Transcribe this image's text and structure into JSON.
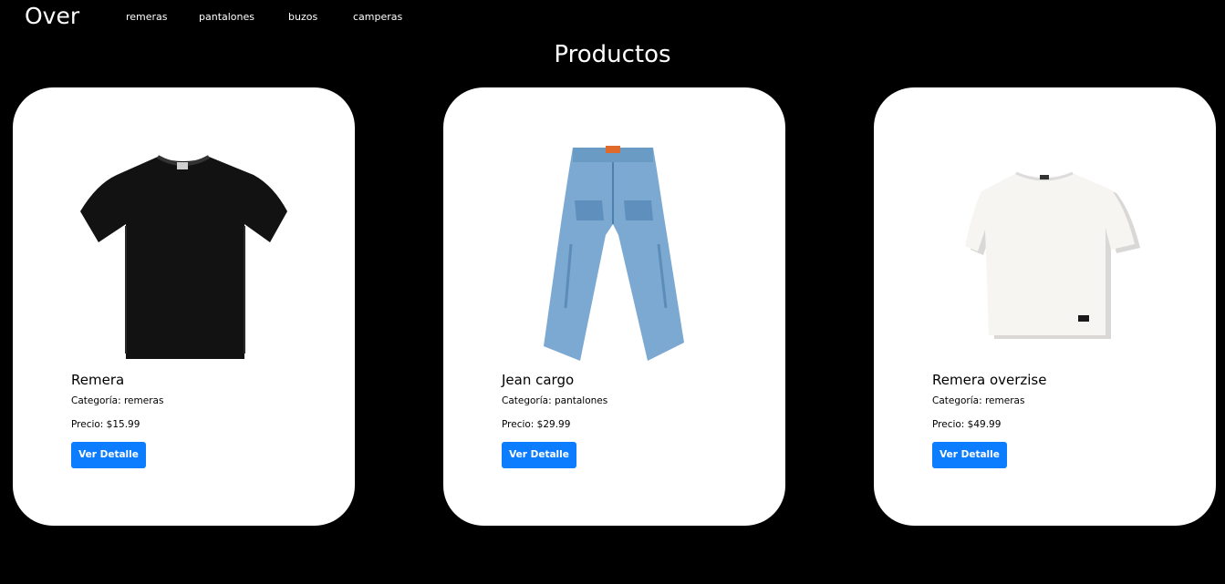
{
  "navbar": {
    "brand": "Over",
    "links": [
      "remeras",
      "pantalones",
      "buzos",
      "camperas"
    ]
  },
  "page_title": "Productos",
  "products": [
    {
      "title": "Remera",
      "category": "Categoría: remeras",
      "price": "Precio: $15.99",
      "button": "Ver Detalle",
      "image": "black-tshirt-image"
    },
    {
      "title": "Jean cargo",
      "category": "Categoría: pantalones",
      "price": "Precio: $29.99",
      "button": "Ver Detalle",
      "image": "blue-jeans-image"
    },
    {
      "title": "Remera overzise",
      "category": "Categoría: remeras",
      "price": "Precio: $49.99",
      "button": "Ver Detalle",
      "image": "white-tshirt-image"
    }
  ],
  "colors": {
    "background": "#000000",
    "card": "#ffffff",
    "accent": "#0d7dff"
  }
}
